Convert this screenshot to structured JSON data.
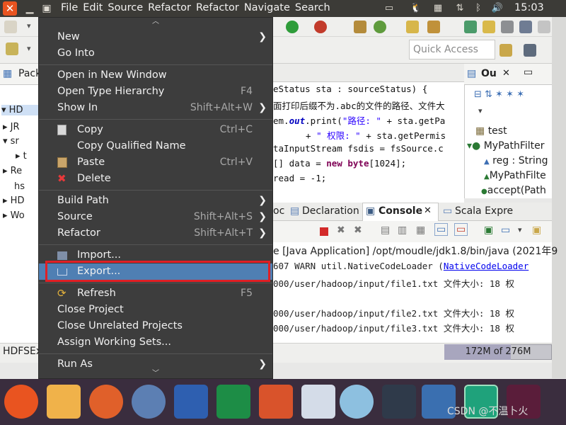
{
  "menubar": {
    "menus": [
      "File",
      "Edit",
      "Source",
      "Refactor",
      "Refactor",
      "Navigate",
      "Search"
    ],
    "clock": "15:03"
  },
  "toolbar": {
    "quick_access": "Quick Access"
  },
  "package_explorer": {
    "tab": "Pack",
    "rows": [
      "HD",
      "JR",
      "sr",
      "t",
      "Re",
      "hs",
      "HD",
      "Wo"
    ]
  },
  "editor": {
    "lines": [
      {
        "pre": "eStatus sta : sourceStatus) {"
      },
      {
        "pre": "面打印后缀不为.abc的文件的路径、文件大"
      },
      {
        "a": "em.",
        "b": "out",
        "c": ".print(",
        "d": "\"路径: \"",
        "e": " + sta.getPa"
      },
      {
        "a": "+ ",
        "b": "\"   权限: \"",
        "c": " + sta.getPermis"
      },
      {
        "pre": "taInputStream fsdis = fsSource.c"
      },
      {
        "a": "[] data = ",
        "b": "new",
        "c": " ",
        "d": "byte",
        "e": "[1024];"
      },
      {
        "pre": "read = -1;"
      }
    ]
  },
  "outline": {
    "tab": "Ou",
    "items": [
      "test",
      "MyPathFilter",
      "reg : String",
      "MyPathFilte",
      "accept(Path"
    ]
  },
  "bottom_panel": {
    "tabs": [
      "oc",
      "Declaration",
      "Console",
      "Scala Expre"
    ],
    "console_header": "e [Java Application] /opt/moudle/jdk1.8/bin/java (2021年9",
    "lines": [
      {
        "text": "607 WARN  util.NativeCodeLoader (",
        "link": "NativeCodeLoader"
      },
      {
        "text": "000/user/hadoop/input/file1.txt    文件大小: 18   权"
      },
      {
        "text": "000/user/hadoop/input/file2.txt    文件大小: 18   权"
      },
      {
        "text": "000/user/hadoop/input/file3.txt    文件大小: 18   权"
      }
    ]
  },
  "status": {
    "left": "HDFSEx",
    "heap": "172M of 276M",
    "heap_used_fraction": 0.62
  },
  "context_menu": {
    "items": [
      {
        "label": "New",
        "submenu": true
      },
      {
        "label": "Go Into"
      },
      {
        "label": "Open in New Window"
      },
      {
        "label": "Open Type Hierarchy",
        "accel": "F4"
      },
      {
        "label": "Show In",
        "accel": "Shift+Alt+W",
        "submenu": true
      },
      {
        "label": "Copy",
        "accel": "Ctrl+C",
        "icon": "copy-icon"
      },
      {
        "label": "Copy Qualified Name",
        "icon": "copy-qualified-icon"
      },
      {
        "label": "Paste",
        "accel": "Ctrl+V",
        "icon": "paste-icon"
      },
      {
        "label": "Delete",
        "icon": "delete-icon"
      },
      {
        "label": "Build Path",
        "submenu": true
      },
      {
        "label": "Source",
        "accel": "Shift+Alt+S",
        "submenu": true
      },
      {
        "label": "Refactor",
        "accel": "Shift+Alt+T",
        "submenu": true
      },
      {
        "label": "Import...",
        "icon": "import-icon"
      },
      {
        "label": "Export...",
        "icon": "export-icon",
        "highlighted": true
      },
      {
        "label": "Refresh",
        "accel": "F5",
        "icon": "refresh-icon"
      },
      {
        "label": "Close Project"
      },
      {
        "label": "Close Unrelated Projects"
      },
      {
        "label": "Assign Working Sets..."
      },
      {
        "label": "Run As",
        "submenu": true
      }
    ]
  },
  "watermark": "CSDN @不温卜火",
  "colors": {
    "menu_bg": "#3d3d3d",
    "highlight": "#4f7fb3",
    "annotation_red": "#e01f25",
    "ubuntu_orange": "#e95420"
  }
}
